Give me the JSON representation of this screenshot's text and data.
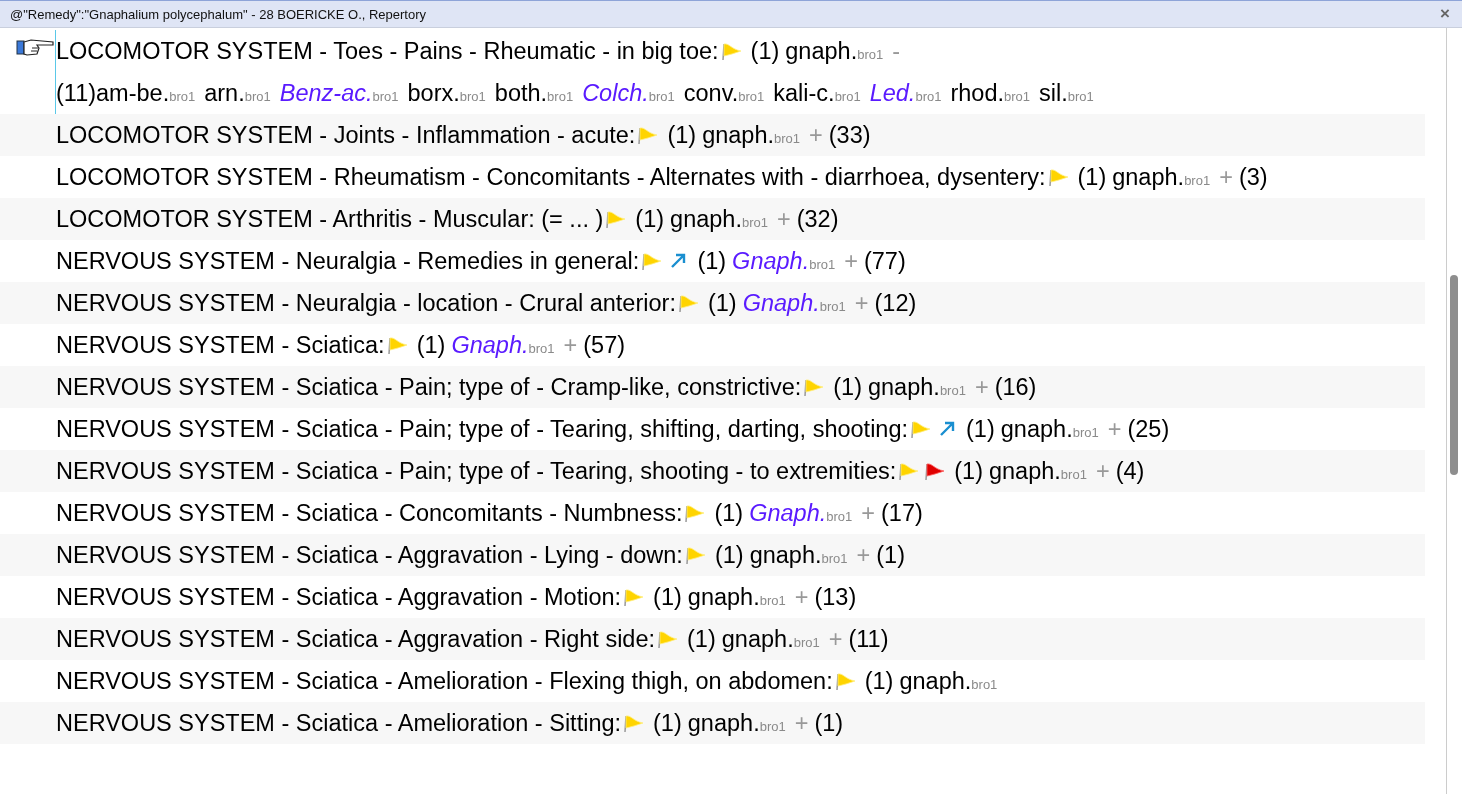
{
  "window": {
    "title": "@\"Remedy\":\"Gnaphalium polycephalum\" - 28 BOERICKE O., Repertory",
    "close": "×"
  },
  "rows": [
    {
      "selected": true,
      "rubric": "LOCOMOTOR SYSTEM - Toes - Pains - Rheumatic - in big toe:",
      "flags": [
        {
          "kind": "yellow"
        }
      ],
      "count": "(1)",
      "remedies": [
        {
          "name": "gnaph.",
          "emphasis": false,
          "source": "bro1"
        }
      ],
      "more": {
        "sign": "-",
        "count": "(11)",
        "remedies": [
          {
            "name": "am-be.",
            "emphasis": false,
            "source": "bro1"
          },
          {
            "name": "arn.",
            "emphasis": false,
            "source": "bro1"
          },
          {
            "name": "Benz-ac.",
            "emphasis": true,
            "source": "bro1"
          },
          {
            "name": "borx.",
            "emphasis": false,
            "source": "bro1"
          },
          {
            "name": "both.",
            "emphasis": false,
            "source": "bro1"
          },
          {
            "name": "Colch.",
            "emphasis": true,
            "source": "bro1"
          },
          {
            "name": "conv.",
            "emphasis": false,
            "source": "bro1"
          },
          {
            "name": "kali-c.",
            "emphasis": false,
            "source": "bro1"
          },
          {
            "name": "Led.",
            "emphasis": true,
            "source": "bro1"
          },
          {
            "name": "rhod.",
            "emphasis": false,
            "source": "bro1"
          },
          {
            "name": "sil.",
            "emphasis": false,
            "source": "bro1"
          }
        ]
      }
    },
    {
      "selected": false,
      "rubric": "LOCOMOTOR SYSTEM - Joints - Inflammation - acute:",
      "flags": [
        {
          "kind": "yellow"
        }
      ],
      "count": "(1)",
      "remedies": [
        {
          "name": "gnaph.",
          "emphasis": false,
          "source": "bro1"
        }
      ],
      "more": {
        "sign": "+",
        "count": "(33)"
      }
    },
    {
      "selected": false,
      "rubric": "LOCOMOTOR SYSTEM - Rheumatism - Concomitants - Alternates with - diarrhoea, dysentery:",
      "flags": [
        {
          "kind": "yellow"
        }
      ],
      "count": "(1)",
      "remedies": [
        {
          "name": "gnaph.",
          "emphasis": false,
          "source": "bro1"
        }
      ],
      "more": {
        "sign": "+",
        "count": "(3)"
      }
    },
    {
      "selected": false,
      "rubric": "LOCOMOTOR SYSTEM - Arthritis - Muscular: (= ... )",
      "flags": [
        {
          "kind": "yellow"
        }
      ],
      "count": "(1)",
      "remedies": [
        {
          "name": "gnaph.",
          "emphasis": false,
          "source": "bro1"
        }
      ],
      "more": {
        "sign": "+",
        "count": "(32)"
      }
    },
    {
      "selected": false,
      "rubric": "NERVOUS SYSTEM - Neuralgia - Remedies in general:",
      "flags": [
        {
          "kind": "yellow"
        },
        {
          "kind": "arrow"
        }
      ],
      "count": "(1)",
      "remedies": [
        {
          "name": "Gnaph.",
          "emphasis": true,
          "source": "bro1"
        }
      ],
      "more": {
        "sign": "+",
        "count": "(77)"
      }
    },
    {
      "selected": false,
      "rubric": "NERVOUS SYSTEM - Neuralgia - location - Crural anterior:",
      "flags": [
        {
          "kind": "yellow"
        }
      ],
      "count": "(1)",
      "remedies": [
        {
          "name": "Gnaph.",
          "emphasis": true,
          "source": "bro1"
        }
      ],
      "more": {
        "sign": "+",
        "count": "(12)"
      }
    },
    {
      "selected": false,
      "rubric": "NERVOUS SYSTEM - Sciatica:",
      "flags": [
        {
          "kind": "yellow"
        }
      ],
      "count": "(1)",
      "remedies": [
        {
          "name": "Gnaph.",
          "emphasis": true,
          "source": "bro1"
        }
      ],
      "more": {
        "sign": "+",
        "count": "(57)"
      }
    },
    {
      "selected": false,
      "rubric": "NERVOUS SYSTEM - Sciatica - Pain; type of - Cramp-like, constrictive:",
      "flags": [
        {
          "kind": "yellow"
        }
      ],
      "count": "(1)",
      "remedies": [
        {
          "name": "gnaph.",
          "emphasis": false,
          "source": "bro1"
        }
      ],
      "more": {
        "sign": "+",
        "count": "(16)"
      }
    },
    {
      "selected": false,
      "rubric": "NERVOUS SYSTEM - Sciatica - Pain; type of - Tearing, shifting, darting, shooting:",
      "flags": [
        {
          "kind": "yellow"
        },
        {
          "kind": "arrow"
        }
      ],
      "count": "(1)",
      "remedies": [
        {
          "name": "gnaph.",
          "emphasis": false,
          "source": "bro1"
        }
      ],
      "more": {
        "sign": "+",
        "count": "(25)"
      }
    },
    {
      "selected": false,
      "rubric": "NERVOUS SYSTEM - Sciatica - Pain; type of - Tearing, shooting - to extremities:",
      "flags": [
        {
          "kind": "yellow"
        },
        {
          "kind": "red"
        }
      ],
      "count": "(1)",
      "remedies": [
        {
          "name": "gnaph.",
          "emphasis": false,
          "source": "bro1"
        }
      ],
      "more": {
        "sign": "+",
        "count": "(4)"
      }
    },
    {
      "selected": false,
      "rubric": "NERVOUS SYSTEM - Sciatica - Concomitants - Numbness:",
      "flags": [
        {
          "kind": "yellow"
        }
      ],
      "count": "(1)",
      "remedies": [
        {
          "name": "Gnaph.",
          "emphasis": true,
          "source": "bro1"
        }
      ],
      "more": {
        "sign": "+",
        "count": "(17)"
      }
    },
    {
      "selected": false,
      "rubric": "NERVOUS SYSTEM - Sciatica - Aggravation - Lying - down:",
      "flags": [
        {
          "kind": "yellow"
        }
      ],
      "count": "(1)",
      "remedies": [
        {
          "name": "gnaph.",
          "emphasis": false,
          "source": "bro1"
        }
      ],
      "more": {
        "sign": "+",
        "count": "(1)"
      }
    },
    {
      "selected": false,
      "rubric": "NERVOUS SYSTEM - Sciatica - Aggravation - Motion:",
      "flags": [
        {
          "kind": "yellow"
        }
      ],
      "count": "(1)",
      "remedies": [
        {
          "name": "gnaph.",
          "emphasis": false,
          "source": "bro1"
        }
      ],
      "more": {
        "sign": "+",
        "count": "(13)"
      }
    },
    {
      "selected": false,
      "rubric": "NERVOUS SYSTEM - Sciatica - Aggravation - Right side:",
      "flags": [
        {
          "kind": "yellow"
        }
      ],
      "count": "(1)",
      "remedies": [
        {
          "name": "gnaph.",
          "emphasis": false,
          "source": "bro1"
        }
      ],
      "more": {
        "sign": "+",
        "count": "(11)"
      }
    },
    {
      "selected": false,
      "rubric": "NERVOUS SYSTEM - Sciatica - Amelioration - Flexing thigh, on abdomen:",
      "flags": [
        {
          "kind": "yellow"
        }
      ],
      "count": "(1)",
      "remedies": [
        {
          "name": "gnaph.",
          "emphasis": false,
          "source": "bro1"
        }
      ]
    },
    {
      "selected": false,
      "rubric": "NERVOUS SYSTEM - Sciatica - Amelioration - Sitting:",
      "flags": [
        {
          "kind": "yellow"
        }
      ],
      "count": "(1)",
      "remedies": [
        {
          "name": "gnaph.",
          "emphasis": false,
          "source": "bro1"
        }
      ],
      "more": {
        "sign": "+",
        "count": "(1)"
      }
    }
  ]
}
